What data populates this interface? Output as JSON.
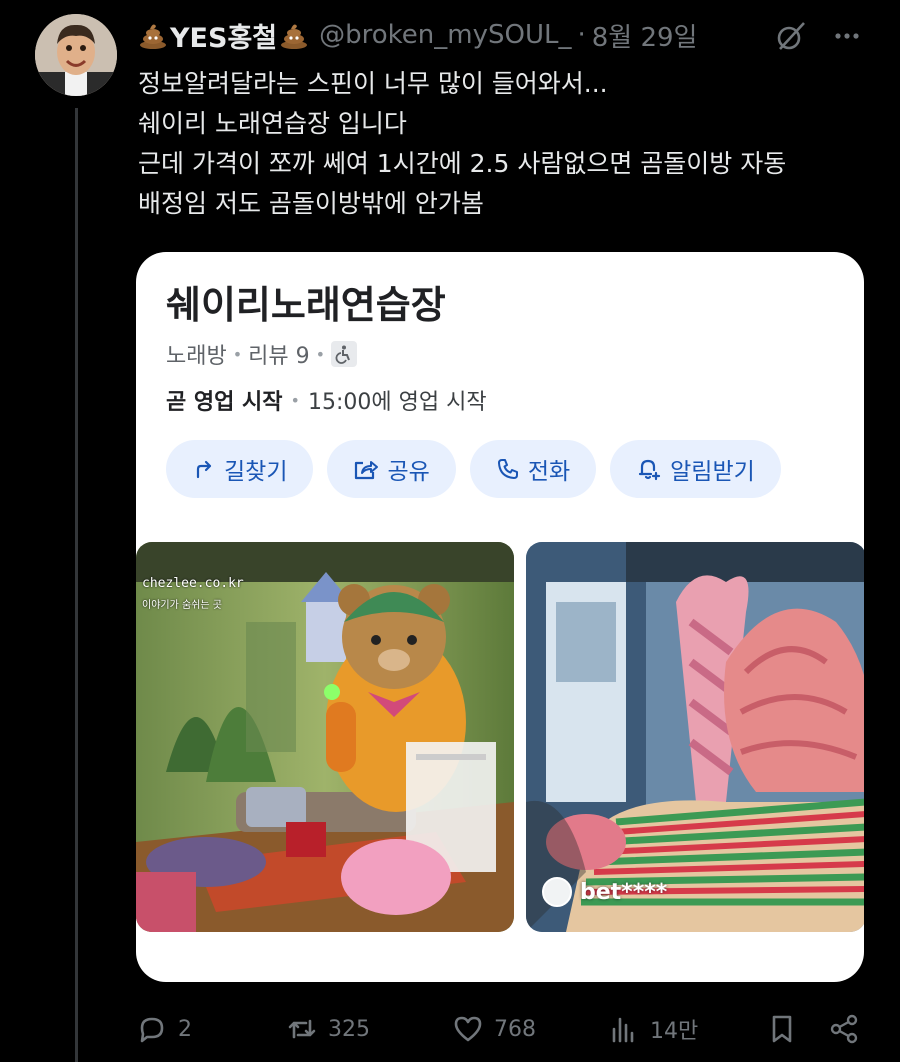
{
  "author": {
    "display_name": "YES홍철",
    "handle": "@broken_mySOUL_",
    "separator": "·",
    "time": "8월 29일"
  },
  "tweet_lines": [
    "정보알려달라는 스핀이 너무 많이 들어와서...",
    "쉐이리 노래연습장 입니다",
    "근데 가격이 쪼까 쎄여 1시간에 2.5  사람없으면 곰돌이방 자동",
    "배정임 저도 곰돌이방밖에 안가봄"
  ],
  "card": {
    "title": "쉐이리노래연습장",
    "category": "노래방",
    "reviews": "리뷰 9",
    "hours_status": "곧 영업 시작",
    "hours_detail": "15:00에 영업 시작",
    "actions": {
      "directions": "길찾기",
      "share": "공유",
      "call": "전화",
      "notify": "알림받기"
    },
    "photo_left_watermark": "chezlee.co.kr",
    "photo_left_caption": "이야기가 숨쉬는 곳",
    "photo_right_reviewer": "bet****"
  },
  "stats": {
    "replies": "2",
    "retweets": "325",
    "likes": "768",
    "views": "14만"
  },
  "icons": [
    "poop-emoji-icon",
    "grok-icon",
    "more-icon",
    "directions-icon",
    "share-icon",
    "phone-icon",
    "bell-icon",
    "accessibility-icon",
    "reply-icon",
    "retweet-icon",
    "like-icon",
    "views-icon",
    "bookmark-icon",
    "share-network-icon"
  ]
}
